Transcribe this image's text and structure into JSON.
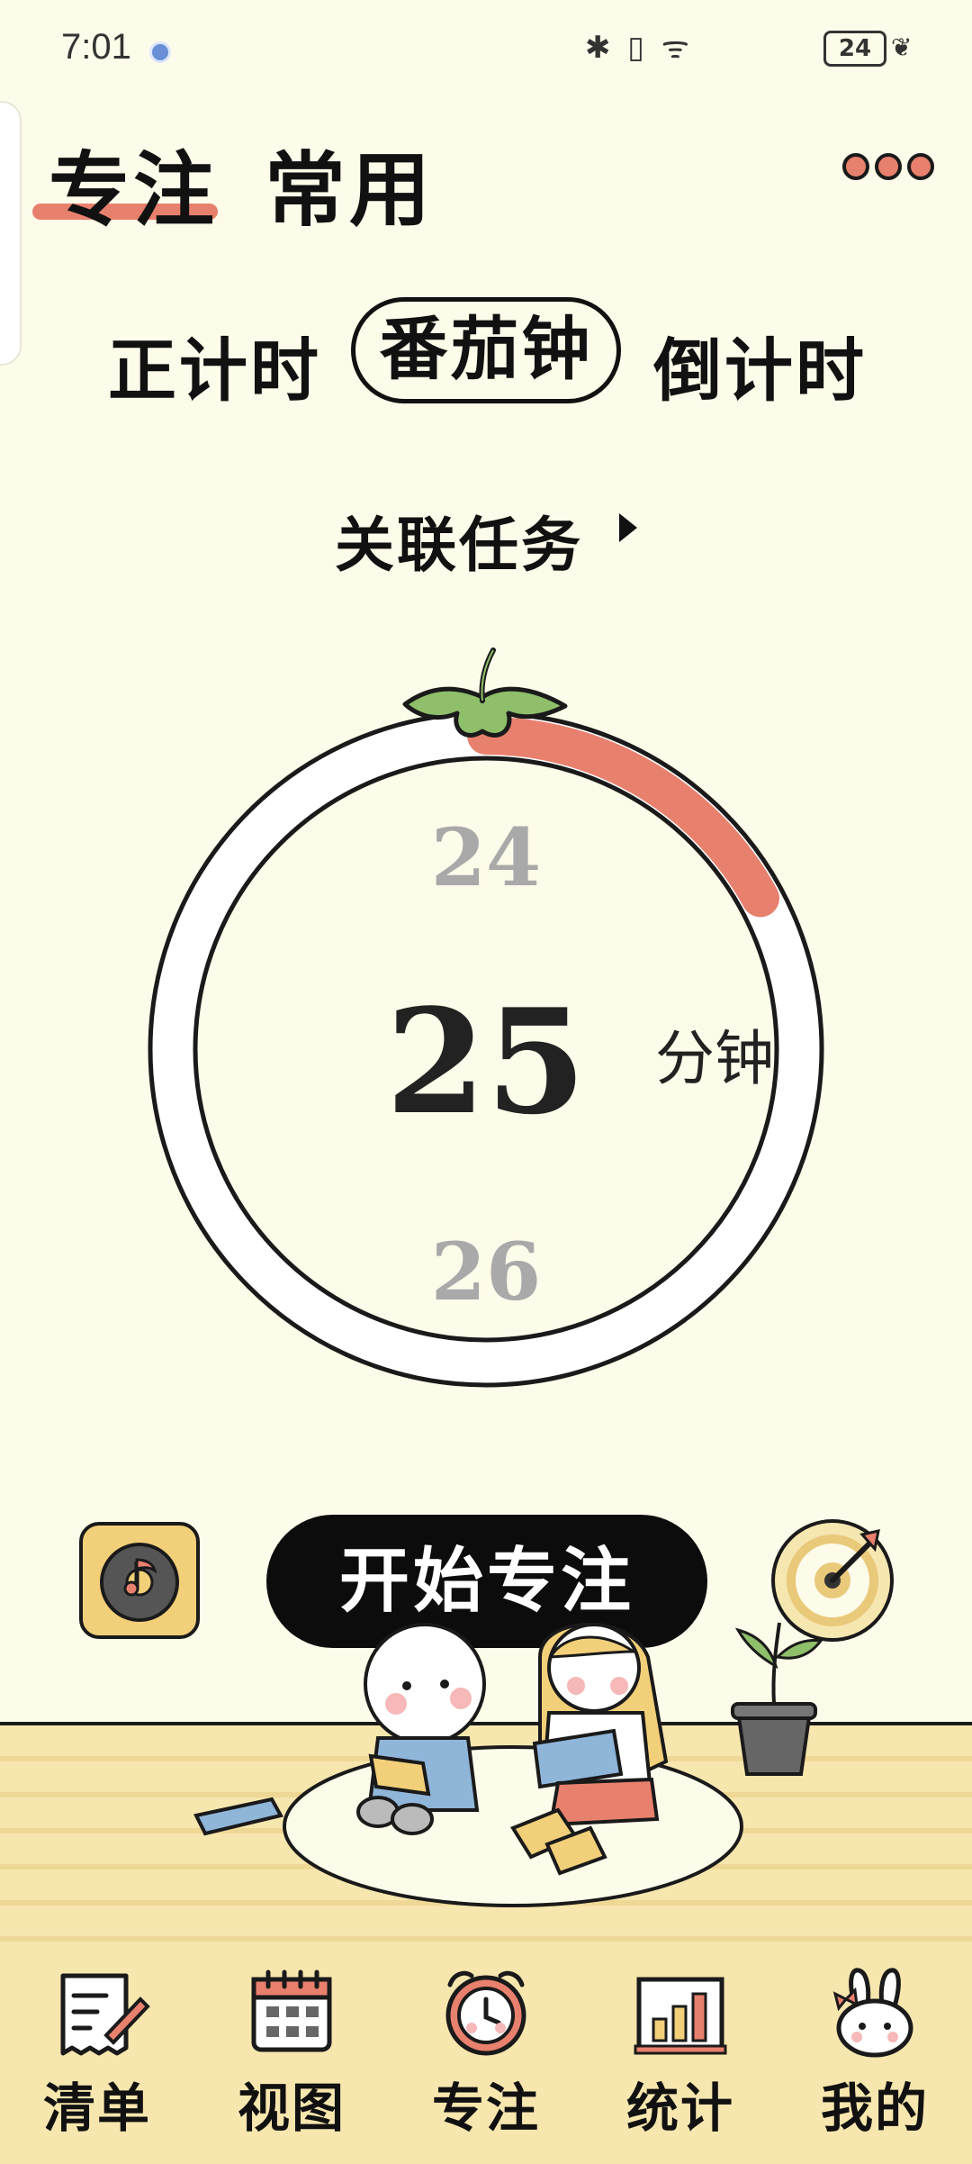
{
  "status_bar": {
    "time": "7:01",
    "icons_text": "✱ ▯ ᯤ",
    "battery": "24"
  },
  "header": {
    "tabs": [
      {
        "label": "专注",
        "active": true
      },
      {
        "label": "常用",
        "active": false
      }
    ],
    "accent_color": "#e8806e"
  },
  "modes": {
    "count_up": "正计时",
    "pomodoro": "番茄钟",
    "count_down": "倒计时",
    "selected": "番茄钟"
  },
  "related_task": "关联任务",
  "dial": {
    "previous": "24",
    "current": "25",
    "next": "26",
    "unit": "分钟",
    "progress_fraction": 0.17,
    "progress_color": "#e8806e"
  },
  "controls": {
    "start_label": "开始专注",
    "music_icon": "music-disc-icon",
    "target_icon": "target-icon"
  },
  "bottom_nav": [
    {
      "label": "清单",
      "icon": "checklist-icon"
    },
    {
      "label": "视图",
      "icon": "calendar-icon"
    },
    {
      "label": "专注",
      "icon": "alarm-clock-icon",
      "active": true
    },
    {
      "label": "统计",
      "icon": "bar-chart-icon"
    },
    {
      "label": "我的",
      "icon": "bunny-icon"
    }
  ]
}
